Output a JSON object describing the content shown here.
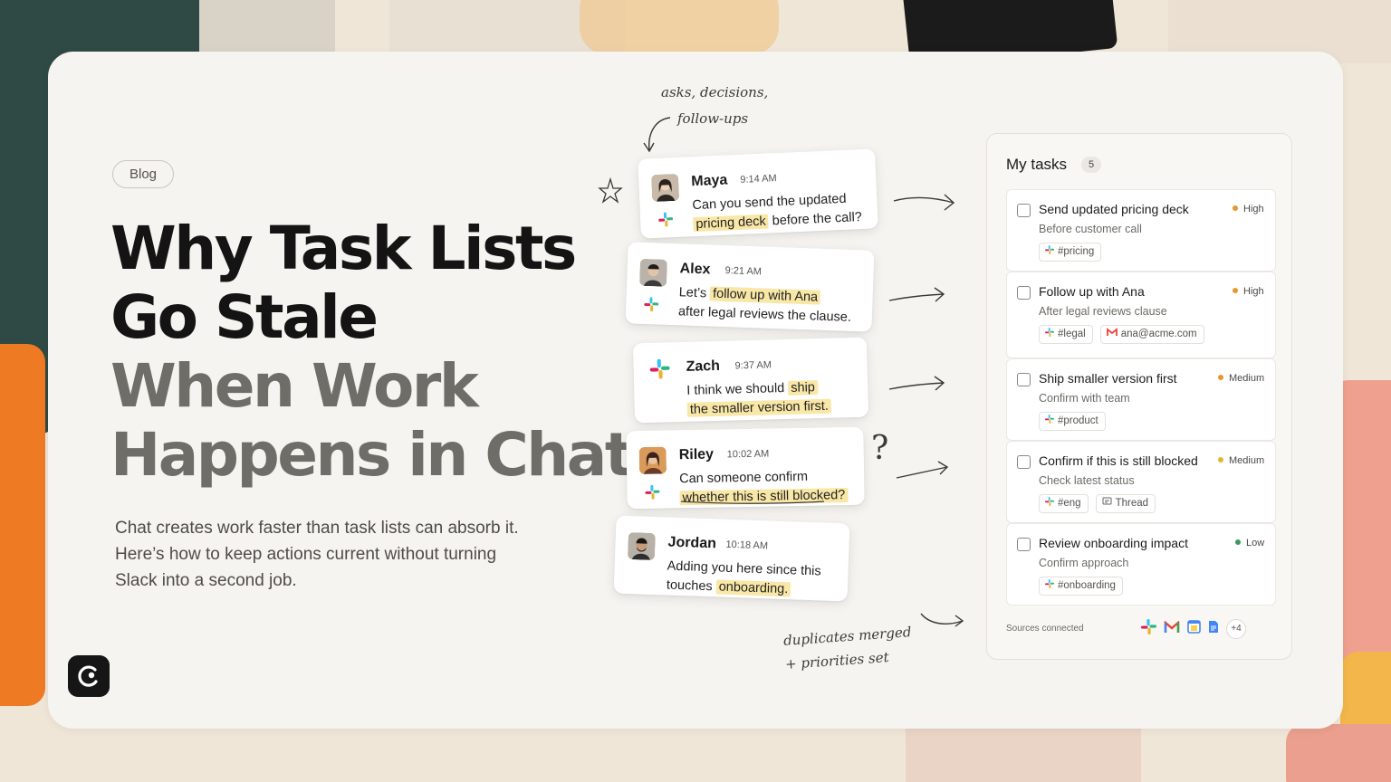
{
  "blog_tag": "Blog",
  "headline": {
    "line1": "Why Task Lists",
    "line2": "Go Stale",
    "line3": "When Work",
    "line4": "Happens in Chat"
  },
  "subtitle": {
    "line1": "Chat creates work faster than task lists can absorb it.",
    "line2": "Here’s how to keep actions current without turning",
    "line3": "Slack into a second job."
  },
  "annotations": {
    "top_line1": "asks, decisions,",
    "top_line2": "follow-ups",
    "bottom_line1": "duplicates merged",
    "bottom_line2": "+ priorities set",
    "question_mark": "?"
  },
  "messages": [
    {
      "name": "Maya",
      "time": "9:14 AM",
      "line1_pre": "Can you send the updated",
      "line2_hl": "pricing deck",
      "line2_post": " before the call?"
    },
    {
      "name": "Alex",
      "time": "9:21 AM",
      "line1_pre": "Let’s ",
      "line1_hl": "follow up with Ana",
      "line2_post": "after legal reviews the clause."
    },
    {
      "name": "Zach",
      "time": "9:37 AM",
      "line1_pre": "I think we should ",
      "line1_hl": "ship",
      "line2_hl": "the smaller version first."
    },
    {
      "name": "Riley",
      "time": "10:02 AM",
      "line1_pre": "Can someone confirm",
      "line2_hl": "whether this is still blocked?"
    },
    {
      "name": "Jordan",
      "time": "10:18 AM",
      "line1_pre": "Adding you here since this",
      "line2_pre": "touches ",
      "line2_hl": "onboarding."
    }
  ],
  "tasks_panel": {
    "title": "My tasks",
    "count": "5",
    "sources_label": "Sources connected",
    "sources_more": "+4",
    "items": [
      {
        "title": "Send updated pricing deck",
        "subtitle": "Before customer call",
        "priority": "High",
        "priority_color": "#e8972b",
        "tags": [
          "#pricing"
        ]
      },
      {
        "title": "Follow up with Ana",
        "subtitle": "After legal reviews clause",
        "priority": "High",
        "priority_color": "#e8972b",
        "tags": [
          "#legal",
          "ana@acme.com"
        ]
      },
      {
        "title": "Ship smaller version first",
        "subtitle": "Confirm with team",
        "priority": "Medium",
        "priority_color": "#e8972b",
        "tags": [
          "#product"
        ]
      },
      {
        "title": "Confirm if this is still blocked",
        "subtitle": "Check latest status",
        "priority": "Medium",
        "priority_color": "#e8b62b",
        "tags": [
          "#eng",
          "Thread"
        ]
      },
      {
        "title": "Review onboarding impact",
        "subtitle": "Confirm approach",
        "priority": "Low",
        "priority_color": "#3a9a5b",
        "tags": [
          "#onboarding"
        ]
      }
    ]
  },
  "colors": {
    "highlight": "#f8e7a6",
    "card_bg": "#f6f4f0",
    "headline_dark": "#141414",
    "headline_muted": "#6f6d68"
  }
}
